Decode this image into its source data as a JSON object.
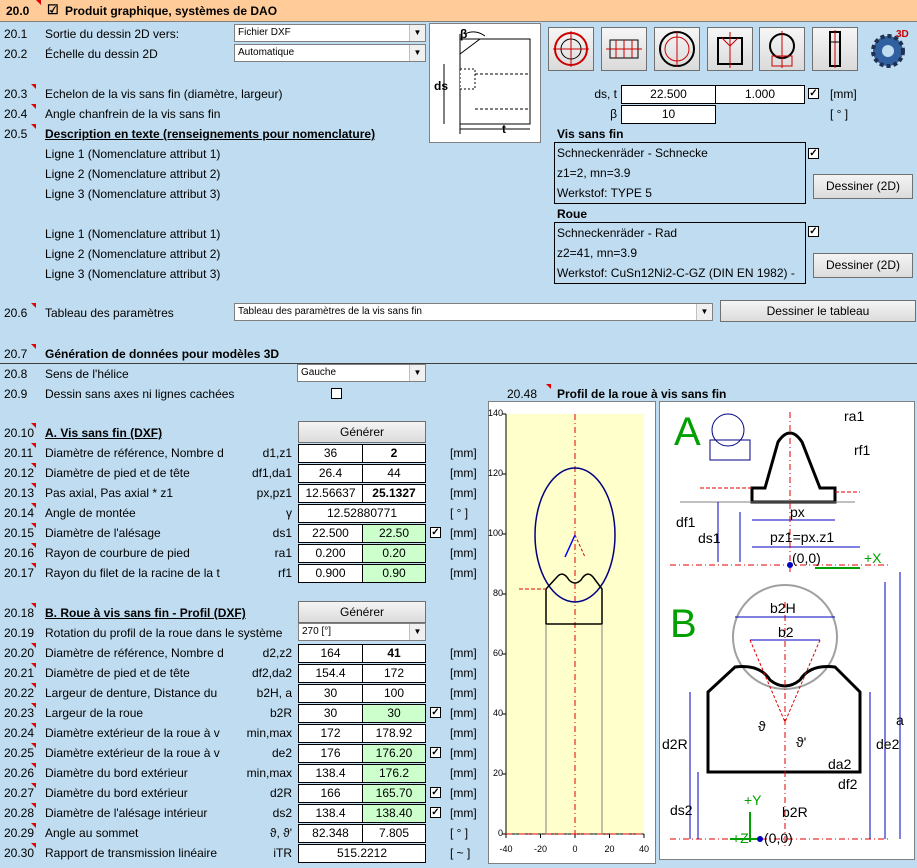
{
  "header": {
    "num": "20.0",
    "title": "Produit graphique, systèmes de DAO",
    "checked": "☑"
  },
  "r201": {
    "num": "20.1",
    "label": "Sortie du dessin 2D vers:",
    "value": "Fichier DXF"
  },
  "r202": {
    "num": "20.2",
    "label": "Échelle du dessin 2D",
    "value": "Automatique"
  },
  "r203": {
    "num": "20.3",
    "label": "Echelon de la vis sans fin (diamètre, largeur)",
    "sym": "ds, t",
    "v1": "22.500",
    "v2": "1.000",
    "unit": "[mm]"
  },
  "r204": {
    "num": "20.4",
    "label": "Angle chanfrein de la vis sans fin",
    "sym": "β",
    "v1": "10",
    "unit": "[ ° ]"
  },
  "r205": {
    "num": "20.5",
    "label": "Description en texte (renseignements pour nomenclature)"
  },
  "worm": {
    "title": "Vis sans fin",
    "l1": "Ligne 1 (Nomenclature attribut 1)",
    "l2": "Ligne 2 (Nomenclature attribut 2)",
    "l3": "Ligne 3 (Nomenclature attribut 3)",
    "t1": "Schneckenräder - Schnecke",
    "t2": "z1=2, mn=3.9",
    "t3": "Werkstof: TYPE 5",
    "btn": "Dessiner (2D)"
  },
  "wheel": {
    "title": "Roue",
    "l1": "Ligne 1 (Nomenclature attribut 1)",
    "l2": "Ligne 2 (Nomenclature attribut 2)",
    "l3": "Ligne 3 (Nomenclature attribut 3)",
    "t1": "Schneckenräder - Rad",
    "t2": "z2=41, mn=3.9",
    "t3": "Werkstof: CuSn12Ni2-C-GZ (DIN EN 1982) -",
    "btn": "Dessiner (2D)"
  },
  "r206": {
    "num": "20.6",
    "label": "Tableau des paramètres",
    "value": "Tableau des paramètres de la vis sans fin",
    "btn": "Dessiner le tableau"
  },
  "r207": {
    "num": "20.7",
    "label": "Génération de données pour modèles 3D"
  },
  "r208": {
    "num": "20.8",
    "label": "Sens de l'hélice",
    "value": "Gauche"
  },
  "r209": {
    "num": "20.9",
    "label": "Dessin sans axes ni lignes cachées"
  },
  "r2048": {
    "num": "20.48",
    "label": "Profil de la roue à vis sans fin"
  },
  "secA": {
    "num": "20.10",
    "label": "A. Vis sans fin (DXF)",
    "btn": "Générer"
  },
  "rowsA": [
    {
      "num": "20.11",
      "label": "Diamètre de référence, Nombre d",
      "sym": "d1,z1",
      "v1": "36",
      "v2": "2",
      "unit": "[mm]"
    },
    {
      "num": "20.12",
      "label": "Diamètre de pied et de tête",
      "sym": "df1,da1",
      "v1": "26.4",
      "v2": "44",
      "unit": "[mm]"
    },
    {
      "num": "20.13",
      "label": "Pas axial, Pas axial * z1",
      "sym": "px,pz1",
      "v1": "12.56637",
      "v2": "25.1327",
      "unit": "[mm]"
    },
    {
      "num": "20.14",
      "label": "Angle de montée",
      "sym": "γ",
      "v1": "12.52880771",
      "unit": "[ ° ]"
    },
    {
      "num": "20.15",
      "label": "Diamètre de l'alésage",
      "sym": "ds1",
      "v1": "22.500",
      "v2": "22.50",
      "unit": "[mm]"
    },
    {
      "num": "20.16",
      "label": "Rayon de courbure de pied",
      "sym": "ra1",
      "v1": "0.200",
      "v2": "0.20",
      "unit": "[mm]"
    },
    {
      "num": "20.17",
      "label": "Rayon du filet de la racine de la t",
      "sym": "rf1",
      "v1": "0.900",
      "v2": "0.90",
      "unit": "[mm]"
    }
  ],
  "secB": {
    "num": "20.18",
    "label": "B. Roue à vis sans fin - Profil (DXF)",
    "btn": "Générer"
  },
  "r219": {
    "num": "20.19",
    "label": "Rotation du profil de la roue dans le système",
    "value": "270 [°]"
  },
  "rowsB": [
    {
      "num": "20.20",
      "label": "Diamètre de référence, Nombre d",
      "sym": "d2,z2",
      "v1": "164",
      "v2": "41",
      "unit": "[mm]"
    },
    {
      "num": "20.21",
      "label": "Diamètre de pied et de tête",
      "sym": "df2,da2",
      "v1": "154.4",
      "v2": "172",
      "unit": "[mm]"
    },
    {
      "num": "20.22",
      "label": "Largeur de denture, Distance du",
      "sym": "b2H, a",
      "v1": "30",
      "v2": "100",
      "unit": "[mm]"
    },
    {
      "num": "20.23",
      "label": "Largeur de la roue",
      "sym": "b2R",
      "v1": "30",
      "v2": "30",
      "unit": "[mm]"
    },
    {
      "num": "20.24",
      "label": "Diamètre extérieur de la roue à v",
      "sym": "min,max",
      "v1": "172",
      "v2": "178.92",
      "unit": "[mm]"
    },
    {
      "num": "20.25",
      "label": "Diamètre extérieur de la roue à v",
      "sym": "de2",
      "v1": "176",
      "v2": "176.20",
      "unit": "[mm]"
    },
    {
      "num": "20.26",
      "label": "Diamètre du bord extérieur",
      "sym": "min,max",
      "v1": "138.4",
      "v2": "176.2",
      "unit": "[mm]"
    },
    {
      "num": "20.27",
      "label": "Diamètre du bord extérieur",
      "sym": "d2R",
      "v1": "166",
      "v2": "165.70",
      "unit": "[mm]"
    },
    {
      "num": "20.28",
      "label": "Diamètre de l'alésage intérieur",
      "sym": "ds2",
      "v1": "138.4",
      "v2": "138.40",
      "unit": "[mm]"
    },
    {
      "num": "20.29",
      "label": "Angle au sommet",
      "sym": "ϑ, ϑ'",
      "v1": "82.348",
      "v2": "7.805",
      "unit": "[ ° ]"
    },
    {
      "num": "20.30",
      "label": "Rapport de transmission linéaire",
      "sym": "iTR",
      "v1": "515.2212",
      "unit": "[ ~ ]"
    }
  ],
  "plot": {
    "yticks": [
      "140",
      "120",
      "100",
      "80",
      "60",
      "40",
      "20",
      "0"
    ],
    "xticks": [
      "-40",
      "-20",
      "0",
      "20",
      "40"
    ]
  },
  "diagram": {
    "A": "A",
    "B": "B",
    "ra1": "ra1",
    "rf1": "rf1",
    "df1": "df1",
    "ds1": "ds1",
    "px": "px",
    "pz1": "pz1=px.z1",
    "origin": "(0,0)",
    "plusX": "+X",
    "b2H": "b2H",
    "b2": "b2",
    "d2R": "d2R",
    "ds2": "ds2",
    "de2": "de2",
    "da2": "da2",
    "df2": "df2",
    "a": "a",
    "theta": "ϑ",
    "thetaP": "ϑ'",
    "plusY": "+Y",
    "plusZ": "+Z",
    "b2R": "b2R",
    "origin2": "(0,0)"
  },
  "small": {
    "ds": "ds",
    "t": "t",
    "beta": "β"
  }
}
